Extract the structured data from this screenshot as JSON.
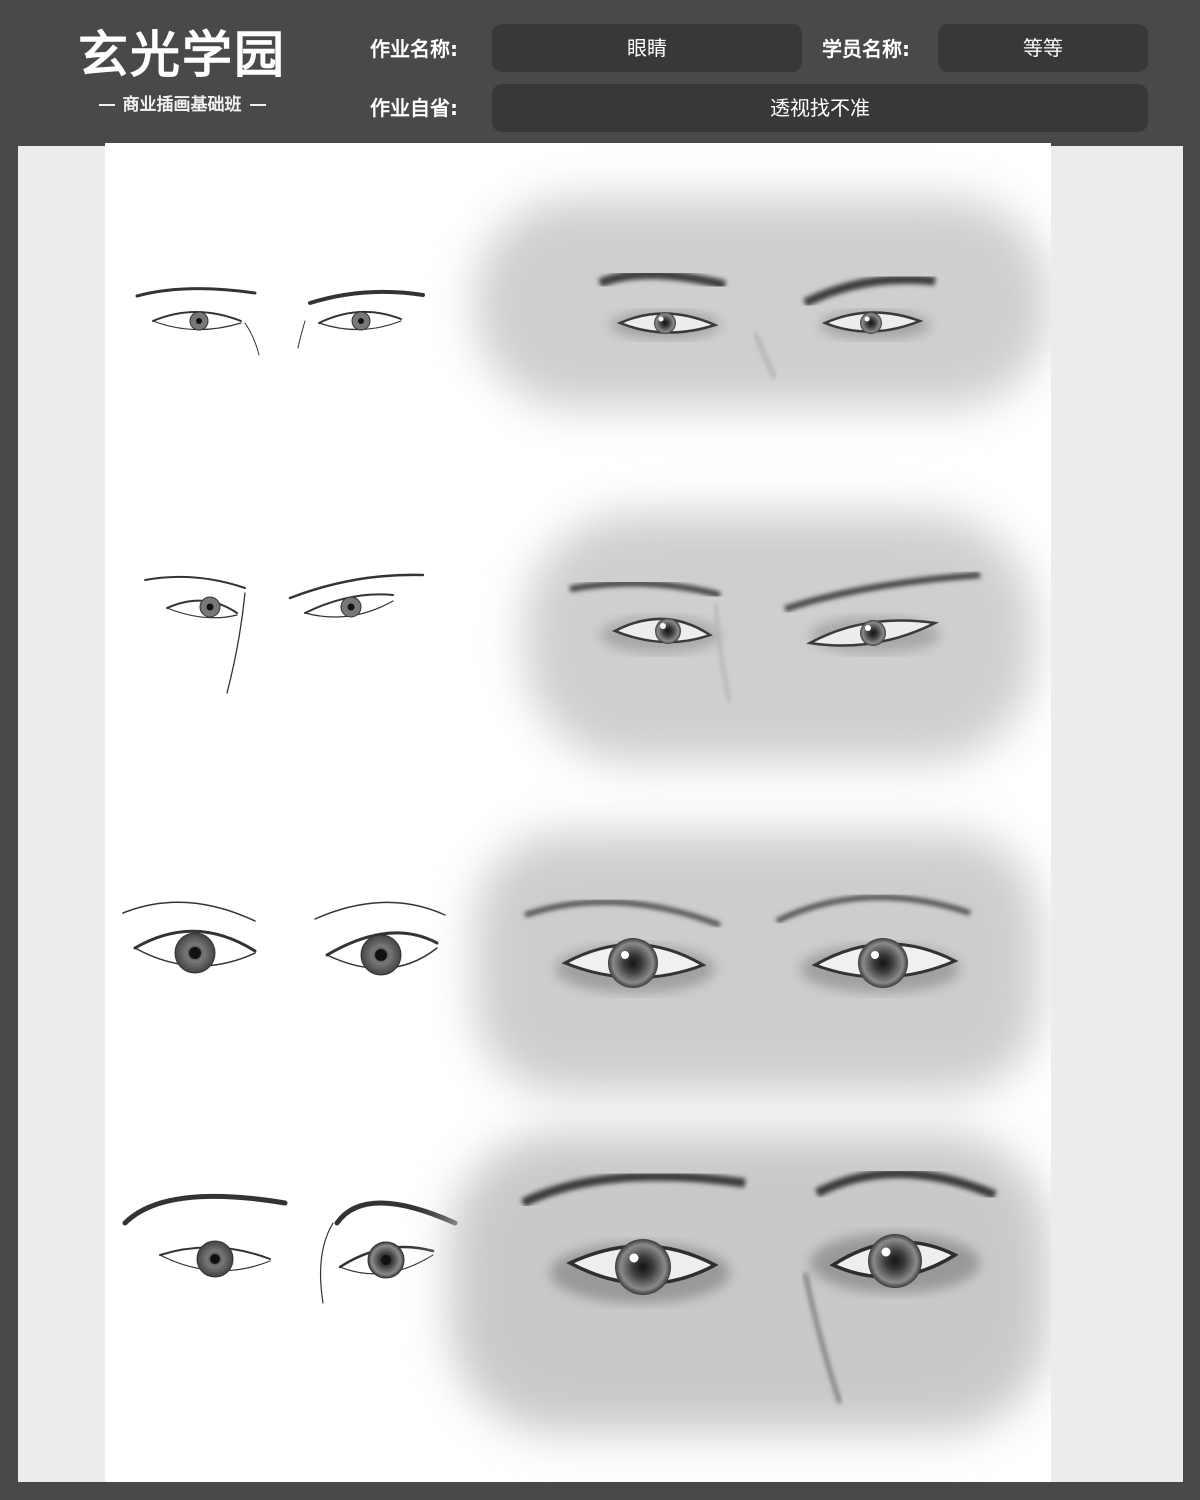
{
  "brand": {
    "title": "玄光学园",
    "subtitle": "商业插画基础班"
  },
  "form": {
    "work_name_label": "作业名称:",
    "work_name_value": "眼睛",
    "student_name_label": "学员名称:",
    "student_name_value": "等等",
    "self_review_label": "作业自省:",
    "self_review_value": "透视找不准"
  },
  "artwork": {
    "subject": "eyes",
    "rows": 4,
    "columns": [
      "line-sketch",
      "grayscale-painting"
    ]
  },
  "colors": {
    "frame": "#4a494a",
    "field_bg": "#393839",
    "panel": "#ececec",
    "paper": "#ffffff"
  }
}
